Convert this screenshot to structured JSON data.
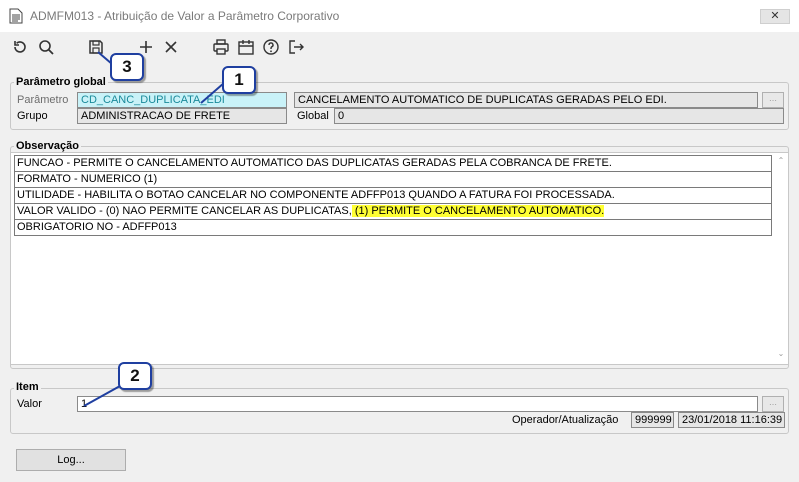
{
  "window": {
    "title": "ADMFM013 - Atribuição de Valor a Parâmetro Corporativo",
    "close_glyph": "✕"
  },
  "toolbar": {
    "buttons": [
      {
        "name": "refresh-icon"
      },
      {
        "name": "search-icon"
      },
      {
        "name": "save-icon"
      },
      {
        "name": "add-icon"
      },
      {
        "name": "delete-icon"
      },
      {
        "name": "print-icon"
      },
      {
        "name": "calendar-icon"
      },
      {
        "name": "help-icon"
      },
      {
        "name": "exit-icon"
      }
    ]
  },
  "parametro_global": {
    "legend": "Parâmetro global",
    "parametro_label": "Parâmetro",
    "parametro_value": "CD_CANC_DUPLICATA_EDI",
    "parametro_desc": "CANCELAMENTO AUTOMATICO DE DUPLICATAS GERADAS PELO EDI.",
    "grupo_label": "Grupo",
    "grupo_value": "ADMINISTRACAO DE FRETE",
    "global_label": "Global",
    "global_value": "0"
  },
  "observacao": {
    "legend": "Observação",
    "lines": [
      "FUNCAO - PERMITE O CANCELAMENTO AUTOMATICO DAS DUPLICATAS GERADAS PELA COBRANCA DE FRETE.",
      "FORMATO - NUMERICO (1)",
      "UTILIDADE - HABILITA O BOTAO CANCELAR NO COMPONENTE ADFFP013 QUANDO A FATURA FOI PROCESSADA.",
      "VALOR VALIDO - (0) NAO PERMITE CANCELAR AS DUPLICATAS,",
      "OBRIGATORIO NO - ADFFP013"
    ],
    "highlight_text": " (1) PERMITE O CANCELAMENTO AUTOMATICO.",
    "highlight_color": "#ffff33"
  },
  "item": {
    "legend": "Item",
    "valor_label": "Valor",
    "valor_value": "1",
    "operador_label": "Operador/Atualização",
    "operador_value": "999999",
    "atualizacao_value": "23/01/2018 11:16:39"
  },
  "log_button": "Log...",
  "callouts": [
    "1",
    "2",
    "3"
  ],
  "colors": {
    "callout_border": "#1f3fa0",
    "cyan_field": "#c9f2f8"
  }
}
